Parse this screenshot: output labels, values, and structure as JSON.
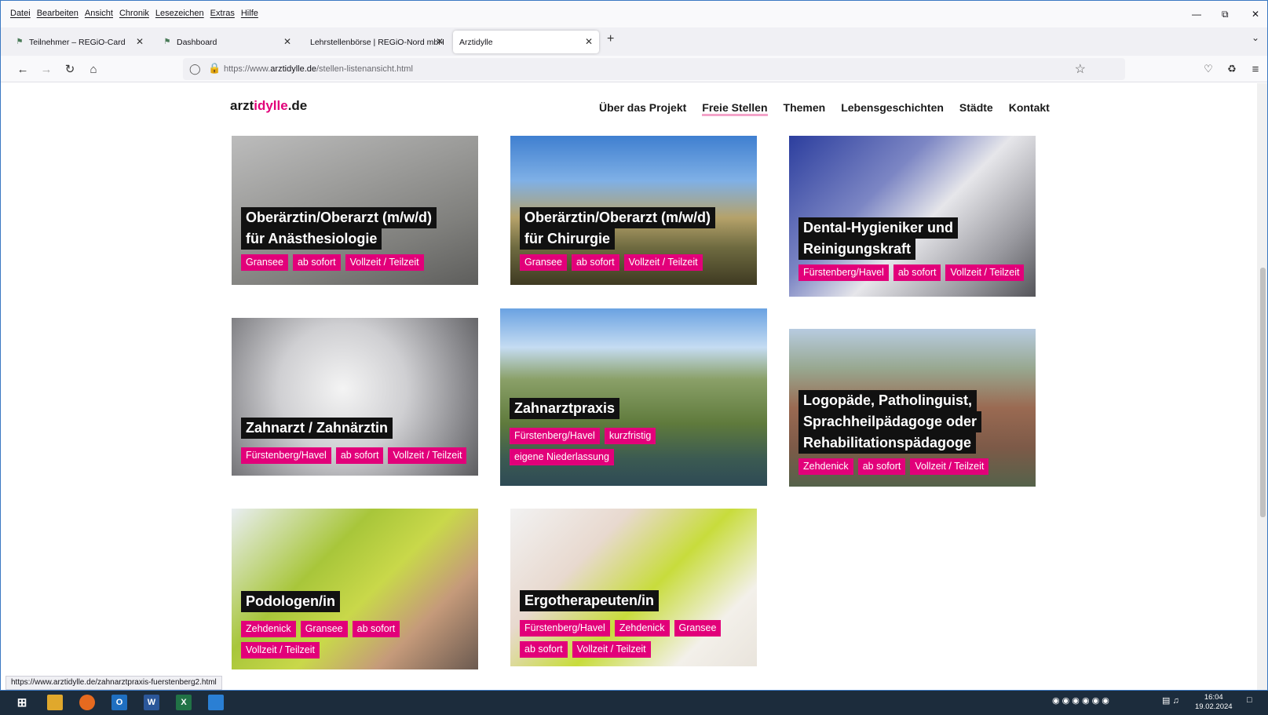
{
  "menubar": {
    "items": [
      "Datei",
      "Bearbeiten",
      "Ansicht",
      "Chronik",
      "Lesezeichen",
      "Extras",
      "Hilfe"
    ]
  },
  "tabs": [
    {
      "label": "Teilnehmer – REGiO-Card",
      "icon": "regio-favicon"
    },
    {
      "label": "Dashboard",
      "icon": "regio-favicon"
    },
    {
      "label": "Lehrstellenbörse | REGiO-Nord mbH",
      "icon": ""
    },
    {
      "label": "Arztidylle",
      "icon": ""
    }
  ],
  "address": {
    "prefix": "https://www.",
    "domain": "arztidylle.de",
    "path": "/stellen-listenansicht.html"
  },
  "site": {
    "logo": {
      "part1": "arzt",
      "part2": "idylle",
      "part3": ".de"
    },
    "nav": [
      "Über das Projekt",
      "Freie Stellen",
      "Themen",
      "Lebensgeschichten",
      "Städte",
      "Kontakt"
    ],
    "active_nav": "Freie Stellen"
  },
  "jobs": [
    {
      "title": [
        "Oberärztin/Oberarzt (m/w/d)",
        "für Anästhesiologie"
      ],
      "tags": [
        "Gransee",
        "ab sofort",
        "Vollzeit / Teilzeit"
      ]
    },
    {
      "title": [
        "Oberärztin/Oberarzt (m/w/d)",
        "für Chirurgie"
      ],
      "tags": [
        "Gransee",
        "ab sofort",
        "Vollzeit / Teilzeit"
      ]
    },
    {
      "title": [
        "Dental-Hygieniker und",
        "Reinigungskraft"
      ],
      "tags": [
        "Fürstenberg/Havel",
        "ab sofort",
        "Vollzeit / Teilzeit"
      ]
    },
    {
      "title": [
        "Zahnarzt / Zahnärztin"
      ],
      "tags": [
        "Fürstenberg/Havel",
        "ab sofort",
        "Vollzeit / Teilzeit"
      ]
    },
    {
      "title": [
        "Zahnarztpraxis"
      ],
      "tags": [
        "Fürstenberg/Havel",
        "kurzfristig",
        "eigene Niederlassung"
      ]
    },
    {
      "title": [
        "Logopäde, Patholinguist,",
        "Sprachheilpädagoge oder",
        "Rehabilitationspädagoge"
      ],
      "tags": [
        "Zehdenick",
        "ab sofort",
        "Vollzeit / Teilzeit"
      ]
    },
    {
      "title": [
        "Podologen/in"
      ],
      "tags": [
        "Zehdenick",
        "Gransee",
        "ab sofort",
        "Vollzeit / Teilzeit"
      ]
    },
    {
      "title": [
        "Ergotherapeuten/in"
      ],
      "tags": [
        "Fürstenberg/Havel",
        "Zehdenick",
        "Gransee",
        "ab sofort",
        "Vollzeit / Teilzeit"
      ]
    }
  ],
  "status_url": "https://www.arztidylle.de/zahnarztpraxis-fuerstenberg2.html",
  "clock": {
    "time": "16:04",
    "date": "19.02.2024"
  },
  "colors": {
    "brand_pink": "#e2007a",
    "title_bg": "#111111",
    "taskbar": "#1c2c3c"
  }
}
